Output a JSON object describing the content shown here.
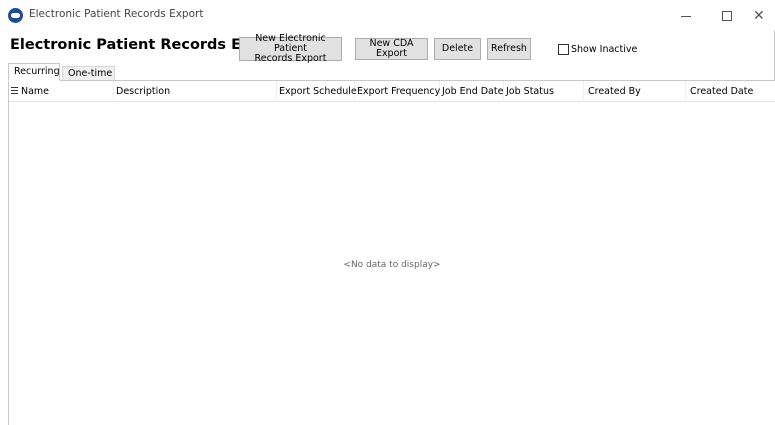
{
  "window": {
    "title": "Electronic Patient Records Export",
    "controls": {
      "minimize": "—",
      "maximize": "☐",
      "close": "✕"
    }
  },
  "header": {
    "page_title": "Electronic Patient Records Export",
    "buttons": {
      "new_epr_line1": "New Electronic Patient",
      "new_epr_line2": "Records Export",
      "new_cda": "New CDA Export",
      "delete": "Delete",
      "refresh": "Refresh"
    },
    "show_inactive_label": "Show Inactive",
    "show_inactive_checked": false
  },
  "tabs": [
    {
      "label": "Recurring",
      "active": true
    },
    {
      "label": "One-time",
      "active": false
    }
  ],
  "grid": {
    "columns": [
      "Name",
      "Description",
      "Export Schedule",
      "Export Frequency",
      "Job End Date",
      "Job Status",
      "Created By",
      "Created Date"
    ],
    "rows": [],
    "empty_text": "<No data to display>"
  }
}
